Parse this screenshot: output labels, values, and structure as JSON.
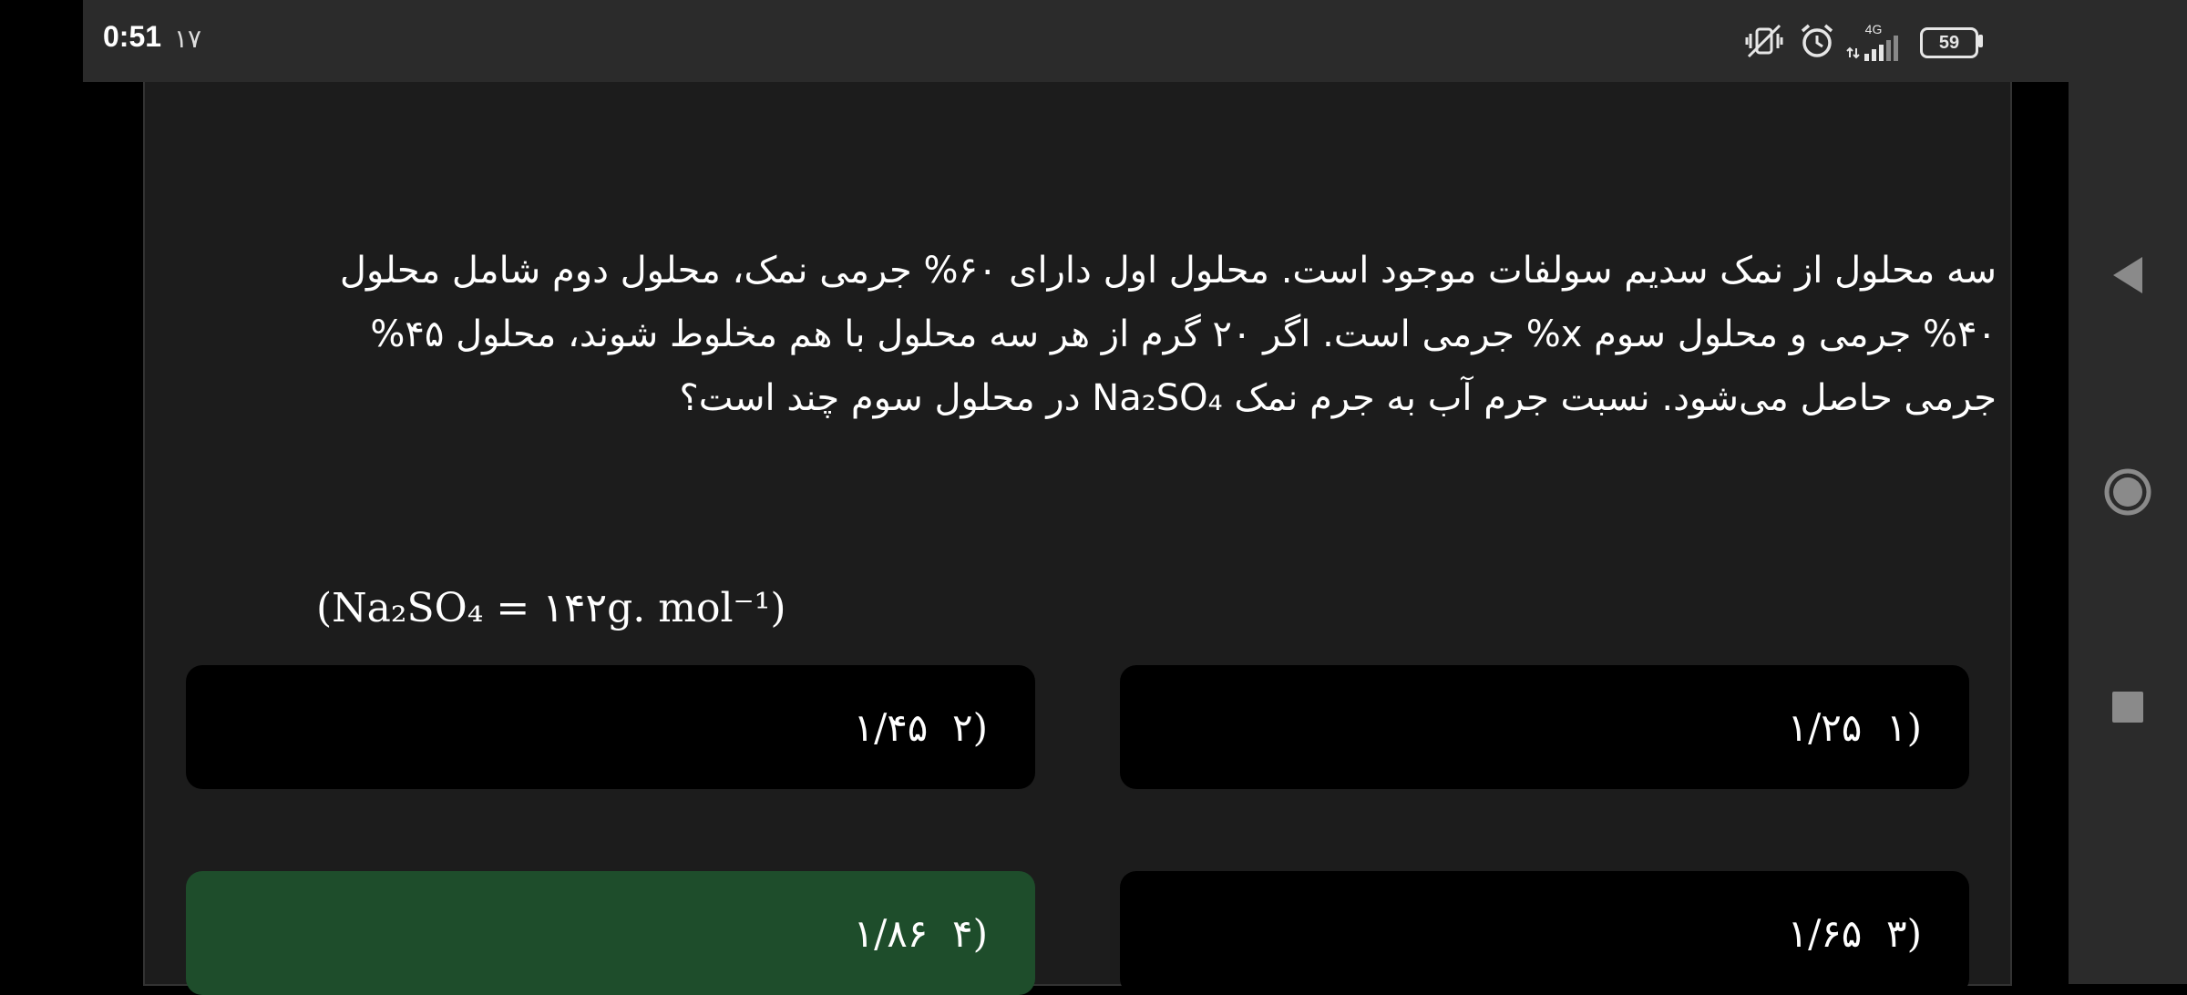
{
  "status_bar": {
    "time": "0:51",
    "extra": "۱۷",
    "network": "4G",
    "battery": "59",
    "icons": [
      "vibrate-off-icon",
      "alarm-icon",
      "signal-icon",
      "battery-icon"
    ]
  },
  "question": {
    "text": "سه محلول از نمک سدیم سولفات موجود است. محلول اول دارای ۶۰% جرمی نمک، محلول دوم شامل محلول ۴۰% جرمی و محلول سوم x% جرمی است. اگر ۲۰ گرم از هر سه محلول با هم مخلوط شوند، محلول ۴۵% جرمی حاصل می‌شود. نسبت جرم آب به جرم نمک Na₂SO₄ در محلول سوم چند است؟",
    "molar_mass": "(Na₂SO₄ = ۱۴۲g. mol⁻¹)"
  },
  "options": [
    {
      "label": "(۱",
      "value": "۱/۲۵"
    },
    {
      "label": "(۲",
      "value": "۱/۴۵"
    },
    {
      "label": "(۳",
      "value": "۱/۶۵"
    },
    {
      "label": "(۴",
      "value": "۱/۸۶",
      "selected": true
    }
  ],
  "colors": {
    "correct_option_bg": "#1e4d2b",
    "option_bg": "#000000",
    "card_bg": "#1c1c1c"
  },
  "nav": {
    "icons": [
      "back-icon",
      "home-icon",
      "recents-icon"
    ]
  }
}
